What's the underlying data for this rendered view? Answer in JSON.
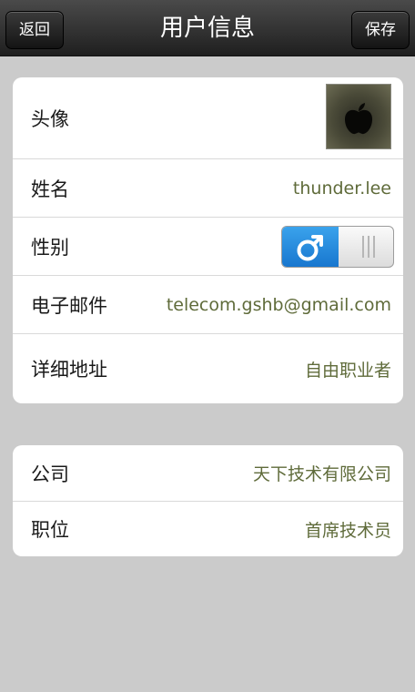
{
  "navbar": {
    "title": "用户信息",
    "back_label": "返回",
    "save_label": "保存"
  },
  "profile": {
    "avatar": {
      "label": "头像",
      "icon": "apple-logo-icon"
    },
    "name": {
      "label": "姓名",
      "value": "thunder.lee"
    },
    "gender": {
      "label": "性别",
      "selected": "male",
      "on_icon": "male-symbol-icon",
      "off_icon": "grip-lines-icon"
    },
    "email": {
      "label": "电子邮件",
      "value": "telecom.gshb@gmail.com"
    },
    "address": {
      "label": "详细地址",
      "value": "自由职业者"
    }
  },
  "work": {
    "company": {
      "label": "公司",
      "value": "天下技术有限公司"
    },
    "position": {
      "label": "职位",
      "value": "首席技术员"
    }
  },
  "colors": {
    "value_text": "#5f6b3a",
    "toggle_on": "#1a86dd",
    "background": "#cbcbcb"
  }
}
